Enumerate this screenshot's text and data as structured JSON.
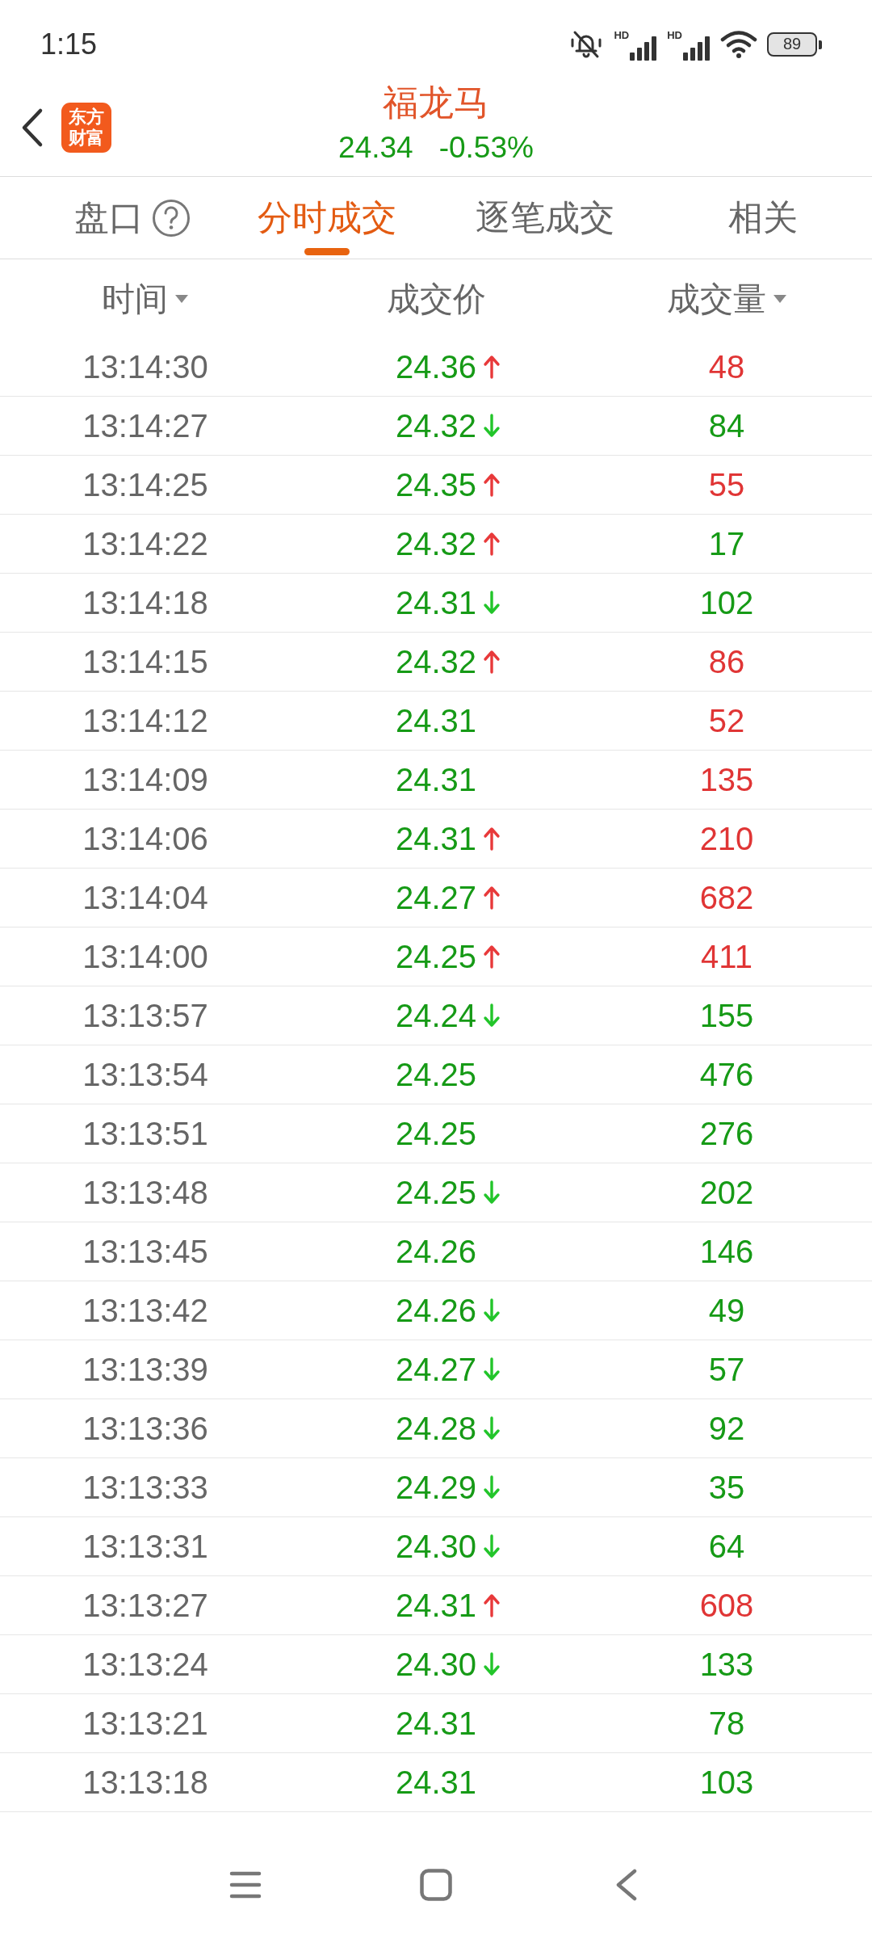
{
  "status_bar": {
    "time": "1:15",
    "signals": [
      {
        "label": "HD"
      },
      {
        "label": "HD"
      }
    ],
    "battery": "89"
  },
  "header": {
    "logo_lines": [
      "东方",
      "财富"
    ],
    "title": "福龙马",
    "price": "24.34",
    "change": "-0.53%"
  },
  "tabs": [
    {
      "label": "盘口",
      "selected": false,
      "help_icon": true
    },
    {
      "label": "分时成交",
      "selected": true,
      "help_icon": false
    },
    {
      "label": "逐笔成交",
      "selected": false,
      "help_icon": false
    },
    {
      "label": "相关",
      "selected": false,
      "help_icon": false
    }
  ],
  "columns": [
    {
      "label": "时间",
      "sort_caret": true
    },
    {
      "label": "成交价",
      "sort_caret": false
    },
    {
      "label": "成交量",
      "sort_caret": true
    }
  ],
  "rows": [
    {
      "time": "13:14:30",
      "price": "24.36",
      "arrow_up": true,
      "arrow_down": false,
      "volume": "48",
      "color": "#e03535"
    },
    {
      "time": "13:14:27",
      "price": "24.32",
      "arrow_up": false,
      "arrow_down": true,
      "volume": "84",
      "color": "#169a16"
    },
    {
      "time": "13:14:25",
      "price": "24.35",
      "arrow_up": true,
      "arrow_down": false,
      "volume": "55",
      "color": "#e03535"
    },
    {
      "time": "13:14:22",
      "price": "24.32",
      "arrow_up": true,
      "arrow_down": false,
      "volume": "17",
      "color": "#169a16"
    },
    {
      "time": "13:14:18",
      "price": "24.31",
      "arrow_up": false,
      "arrow_down": true,
      "volume": "102",
      "color": "#169a16"
    },
    {
      "time": "13:14:15",
      "price": "24.32",
      "arrow_up": true,
      "arrow_down": false,
      "volume": "86",
      "color": "#e03535"
    },
    {
      "time": "13:14:12",
      "price": "24.31",
      "arrow_up": false,
      "arrow_down": false,
      "volume": "52",
      "color": "#e03535"
    },
    {
      "time": "13:14:09",
      "price": "24.31",
      "arrow_up": false,
      "arrow_down": false,
      "volume": "135",
      "color": "#e03535"
    },
    {
      "time": "13:14:06",
      "price": "24.31",
      "arrow_up": true,
      "arrow_down": false,
      "volume": "210",
      "color": "#e03535"
    },
    {
      "time": "13:14:04",
      "price": "24.27",
      "arrow_up": true,
      "arrow_down": false,
      "volume": "682",
      "color": "#e03535"
    },
    {
      "time": "13:14:00",
      "price": "24.25",
      "arrow_up": true,
      "arrow_down": false,
      "volume": "411",
      "color": "#e03535"
    },
    {
      "time": "13:13:57",
      "price": "24.24",
      "arrow_up": false,
      "arrow_down": true,
      "volume": "155",
      "color": "#169a16"
    },
    {
      "time": "13:13:54",
      "price": "24.25",
      "arrow_up": false,
      "arrow_down": false,
      "volume": "476",
      "color": "#169a16"
    },
    {
      "time": "13:13:51",
      "price": "24.25",
      "arrow_up": false,
      "arrow_down": false,
      "volume": "276",
      "color": "#169a16"
    },
    {
      "time": "13:13:48",
      "price": "24.25",
      "arrow_up": false,
      "arrow_down": true,
      "volume": "202",
      "color": "#169a16"
    },
    {
      "time": "13:13:45",
      "price": "24.26",
      "arrow_up": false,
      "arrow_down": false,
      "volume": "146",
      "color": "#169a16"
    },
    {
      "time": "13:13:42",
      "price": "24.26",
      "arrow_up": false,
      "arrow_down": true,
      "volume": "49",
      "color": "#169a16"
    },
    {
      "time": "13:13:39",
      "price": "24.27",
      "arrow_up": false,
      "arrow_down": true,
      "volume": "57",
      "color": "#169a16"
    },
    {
      "time": "13:13:36",
      "price": "24.28",
      "arrow_up": false,
      "arrow_down": true,
      "volume": "92",
      "color": "#169a16"
    },
    {
      "time": "13:13:33",
      "price": "24.29",
      "arrow_up": false,
      "arrow_down": true,
      "volume": "35",
      "color": "#169a16"
    },
    {
      "time": "13:13:31",
      "price": "24.30",
      "arrow_up": false,
      "arrow_down": true,
      "volume": "64",
      "color": "#169a16"
    },
    {
      "time": "13:13:27",
      "price": "24.31",
      "arrow_up": true,
      "arrow_down": false,
      "volume": "608",
      "color": "#e03535"
    },
    {
      "time": "13:13:24",
      "price": "24.30",
      "arrow_up": false,
      "arrow_down": true,
      "volume": "133",
      "color": "#169a16"
    },
    {
      "time": "13:13:21",
      "price": "24.31",
      "arrow_up": false,
      "arrow_down": false,
      "volume": "78",
      "color": "#169a16"
    },
    {
      "time": "13:13:18",
      "price": "24.31",
      "arrow_up": false,
      "arrow_down": false,
      "volume": "103",
      "color": "#169a16"
    }
  ]
}
